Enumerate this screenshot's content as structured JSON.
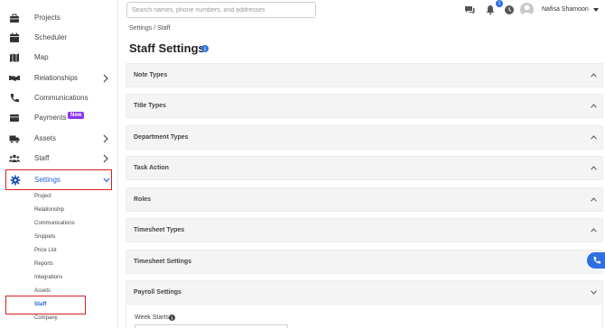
{
  "sidebar": {
    "items": [
      {
        "label": "Projects",
        "icon": "briefcase-icon"
      },
      {
        "label": "Scheduler",
        "icon": "calendar-icon"
      },
      {
        "label": "Map",
        "icon": "map-icon"
      },
      {
        "label": "Relationships",
        "icon": "handshake-icon"
      },
      {
        "label": "Communications",
        "icon": "phone-icon"
      },
      {
        "label": "Payments",
        "icon": "wallet-icon",
        "badge": "New"
      },
      {
        "label": "Assets",
        "icon": "truck-icon"
      },
      {
        "label": "Staff",
        "icon": "users-icon"
      },
      {
        "label": "Settings",
        "icon": "gear-icon"
      }
    ],
    "settings_sub": [
      "Project",
      "Relationship",
      "Communications",
      "Snippets",
      "Price List",
      "Reports",
      "Integrations",
      "Assets",
      "Staff",
      "Company"
    ]
  },
  "header": {
    "search_placeholder": "Search names, phone numbers, and addresses",
    "notification_count": "1",
    "user_name": "Nafisa Shamoon"
  },
  "breadcrumb": "Settings / Staff",
  "page_title": "Staff Settings",
  "panels": [
    "Note Types",
    "Title Types",
    "Department Types",
    "Task Action",
    "Roles",
    "Timesheet Types",
    "Timesheet Settings",
    "Payroll Settings"
  ],
  "payroll": {
    "week_starts_label": "Week Starts"
  },
  "colors": {
    "accent": "#2563d9",
    "highlight_border": "#d62020",
    "new_badge": "#8a35f5"
  }
}
